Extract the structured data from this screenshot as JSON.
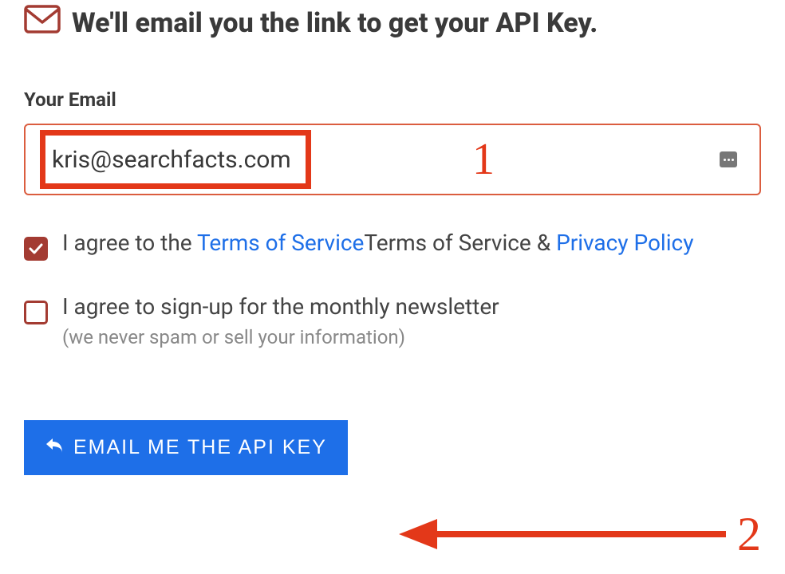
{
  "heading": "We'll email you the link to get your API Key.",
  "form": {
    "email_label": "Your Email",
    "email_value": "kris@searchfacts.com"
  },
  "annotations": {
    "step1": "1",
    "step2": "2"
  },
  "agreements": {
    "tos": {
      "prefix": "I agree to the ",
      "link1_label": "Terms of Service",
      "mid": "Terms of Service & ",
      "link2_label": "Privacy Policy"
    },
    "newsletter": {
      "label": "I agree to sign-up for the monthly newsletter",
      "subnote": "(we never spam or sell your information)"
    }
  },
  "button": {
    "label": "EMAIL ME THE API KEY"
  },
  "colors": {
    "accent_red": "#e33819",
    "brand_blue": "#1e6fe8",
    "checkbox_fill": "#a33b32"
  }
}
